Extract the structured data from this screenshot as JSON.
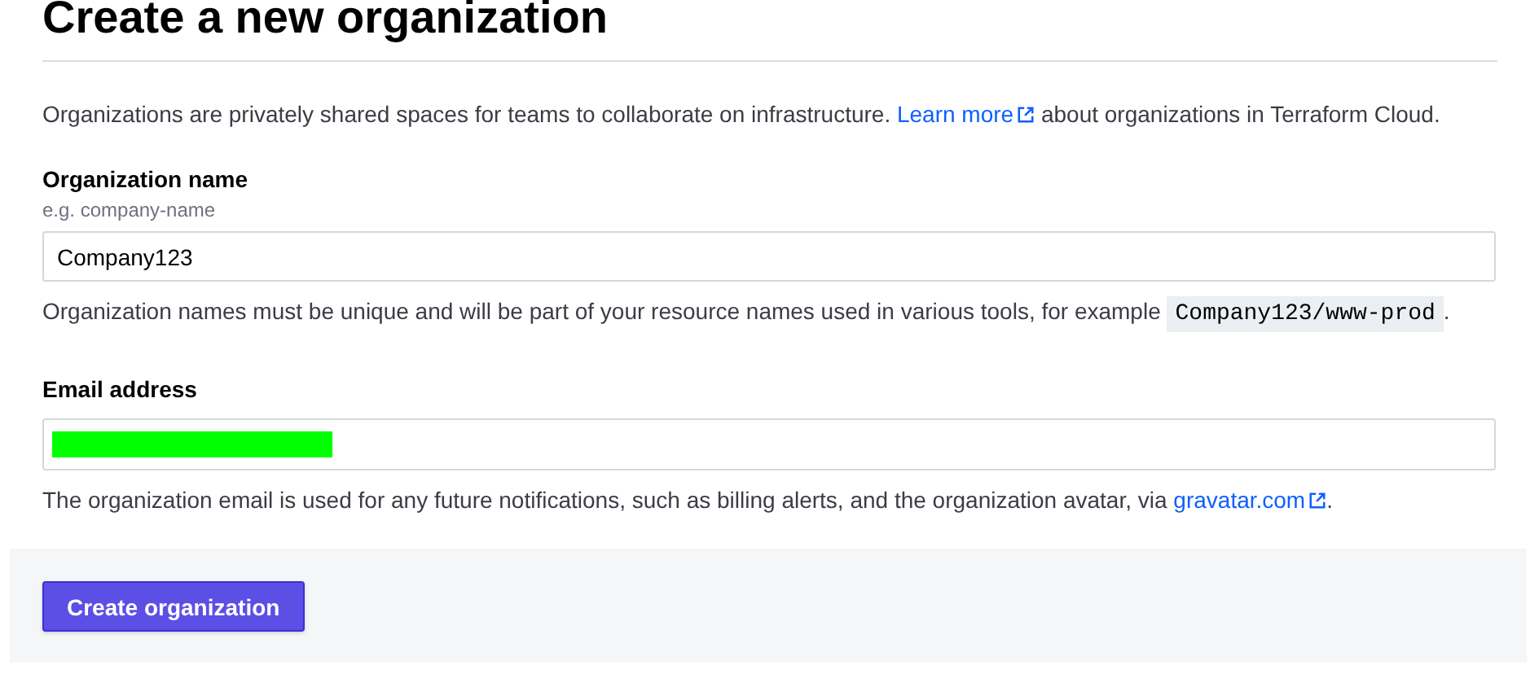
{
  "page": {
    "title": "Create a new organization"
  },
  "intro": {
    "before": "Organizations are privately shared spaces for teams to collaborate on infrastructure.",
    "link": "Learn more",
    "after": "about organizations in Terraform Cloud."
  },
  "name_field": {
    "label": "Organization name",
    "hint": "e.g. company-name",
    "value": "Company123",
    "help_before": "Organization names must be unique and will be part of your resource names used in various tools, for example",
    "help_code": "Company123/www-prod",
    "help_after": "."
  },
  "email_field": {
    "label": "Email address",
    "help_before": "The organization email is used for any future notifications, such as billing alerts, and the organization avatar, via",
    "help_link": "gravatar.com",
    "help_after": "."
  },
  "submit_button": {
    "label": "Create organization"
  }
}
